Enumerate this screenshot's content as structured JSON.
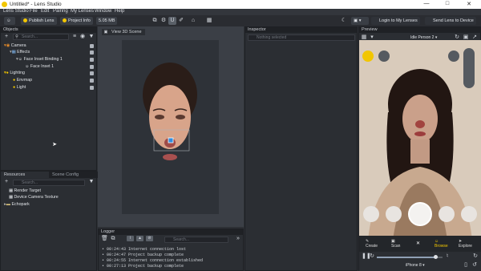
{
  "window": {
    "title": "Untitled* - Lens Studio"
  },
  "menu": [
    "Lens Studio",
    "File",
    "Edit",
    "Pairing",
    "My Lenses",
    "Window",
    "Help"
  ],
  "toolbar": {
    "publish": "Publish Lens",
    "project_info": "Project Info",
    "size": "5.05 MB",
    "login": "Login to My Lenses",
    "send": "Send Lens to Device"
  },
  "objects": {
    "title": "Objects",
    "search_placeholder": "Search...",
    "items": [
      "Camera",
      "Effects",
      "Face Inset Binding 1",
      "Face Inset 1",
      "Lighting",
      "Envmap",
      "Light"
    ]
  },
  "viewport": {
    "tab": "View 3D Scene"
  },
  "inspector": {
    "title": "Inspector",
    "empty": "Nothing selected"
  },
  "resources": {
    "tab1": "Resources",
    "tab2": "Scene Config",
    "search_placeholder": "Search...",
    "items": [
      "Render Target",
      "Device Camera Texture",
      "Echopark"
    ]
  },
  "logger": {
    "title": "Logger",
    "search_placeholder": "Search...",
    "lines": [
      {
        "time": "00:24:43",
        "msg": "Internet connection lost"
      },
      {
        "time": "00:24:47",
        "msg": "Project backup complete"
      },
      {
        "time": "00:24:55",
        "msg": "Internet connection established"
      },
      {
        "time": "00:27:13",
        "msg": "Project backup complete"
      }
    ]
  },
  "preview": {
    "title": "Preview",
    "person": "Idle Person 2",
    "device": "iPhone 8",
    "nav": [
      "Create",
      "Scan",
      "Browse",
      "Explore"
    ]
  }
}
